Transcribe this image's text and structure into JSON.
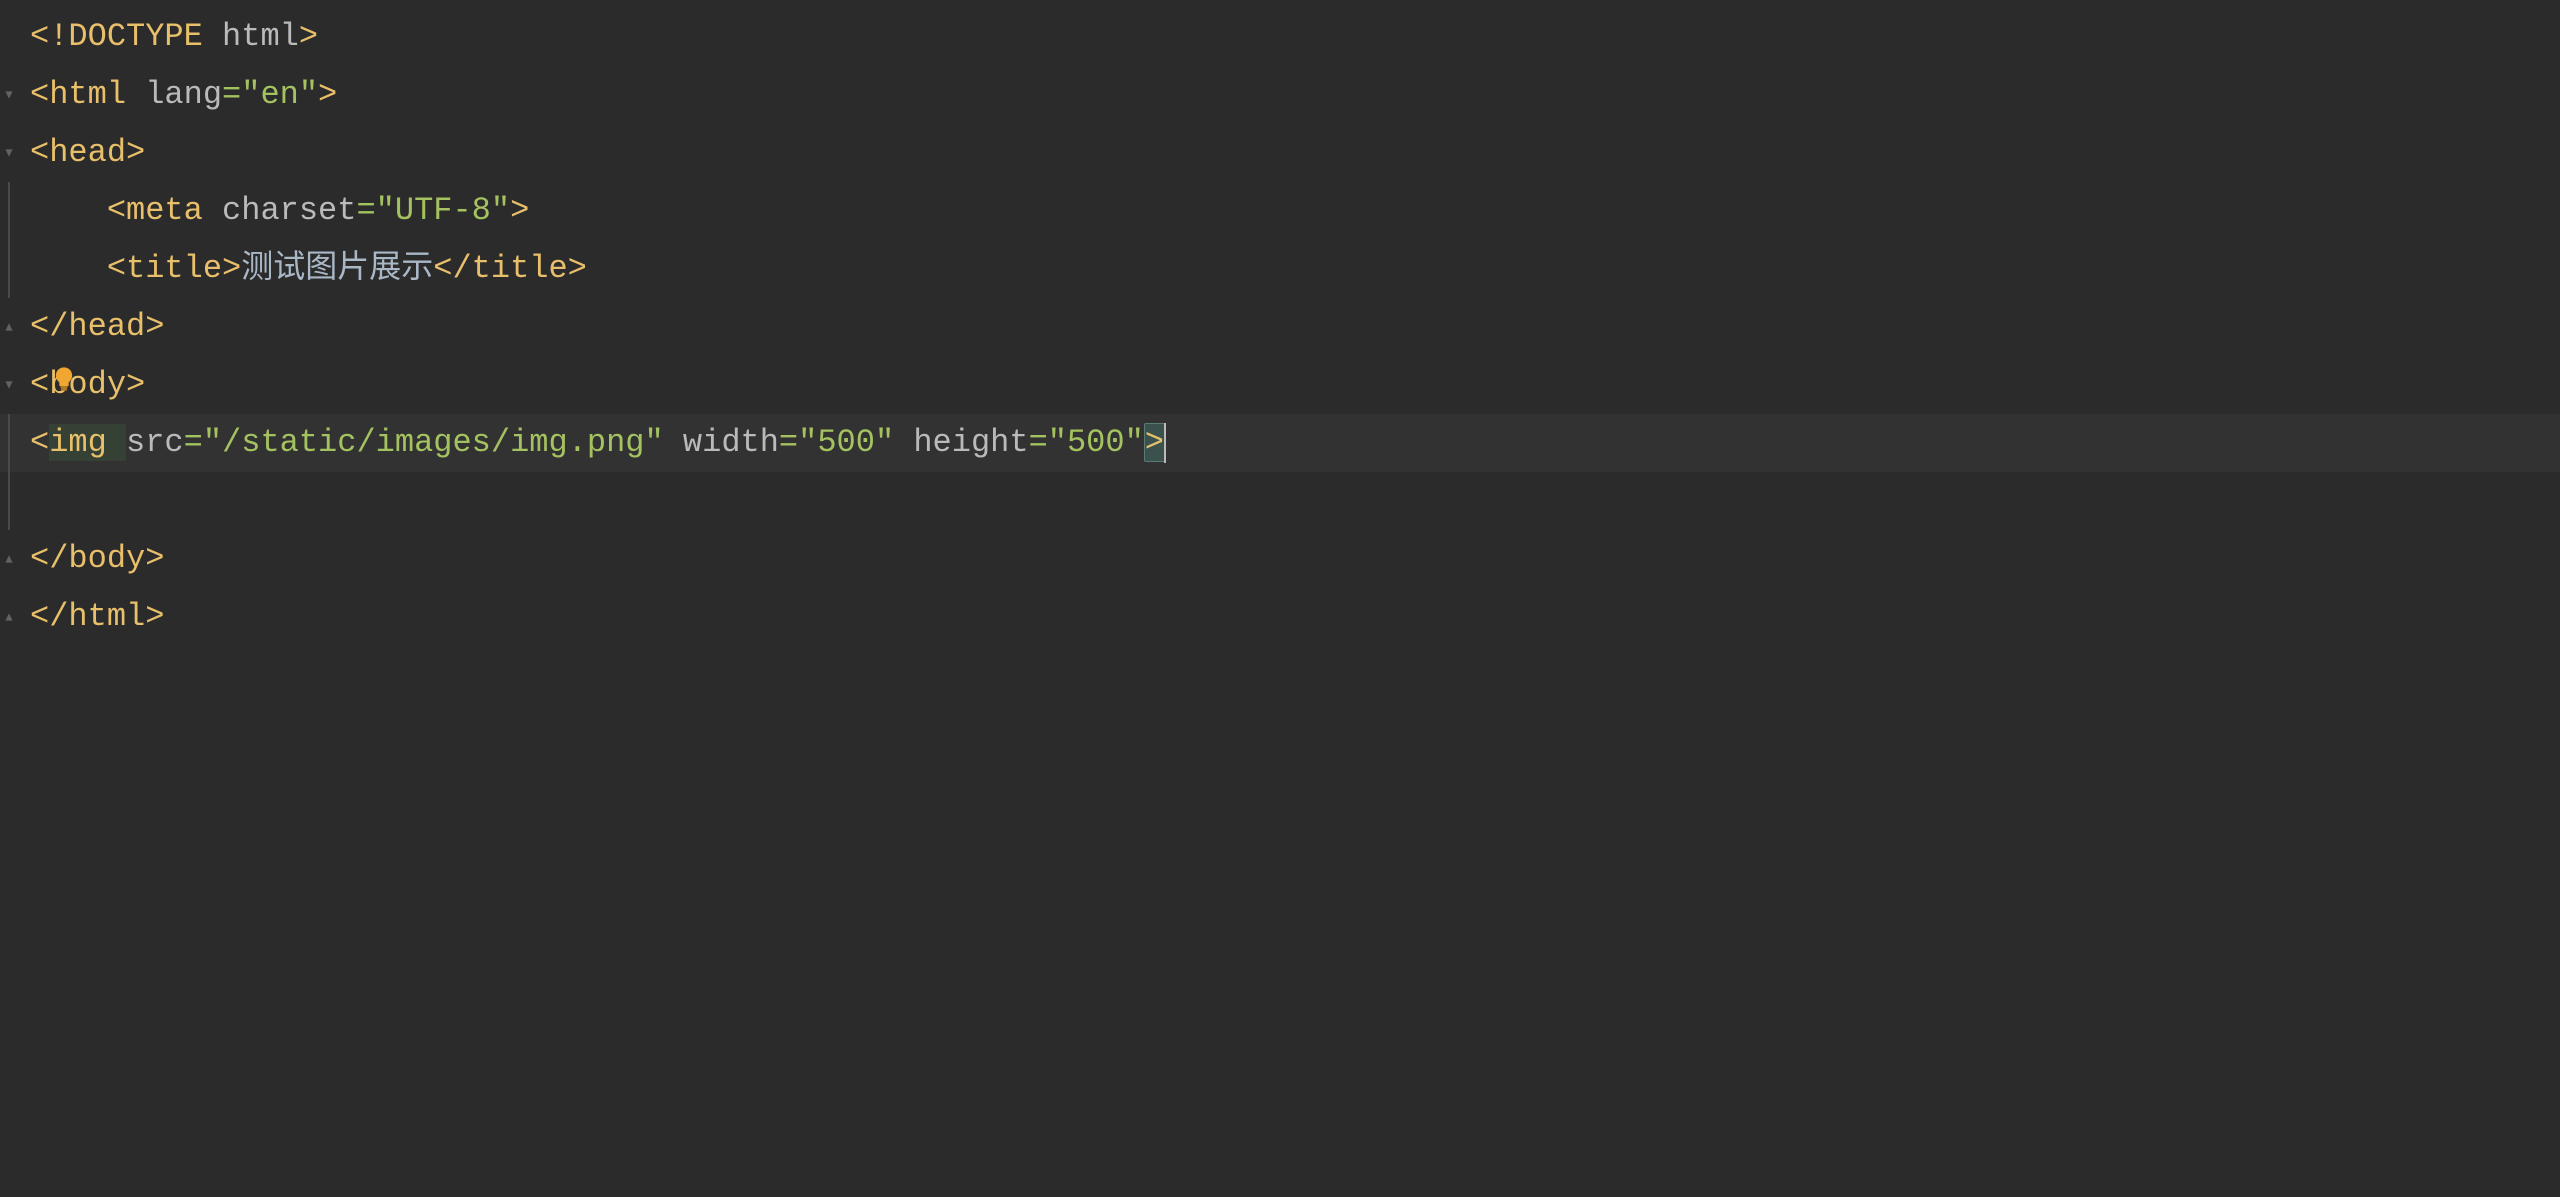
{
  "lines": [
    {
      "tokens": [
        {
          "t": "<!DOCTYPE ",
          "c": "tag"
        },
        {
          "t": "html",
          "c": "attr-name"
        },
        {
          "t": ">",
          "c": "tag"
        }
      ],
      "fold": "none",
      "indent": 0
    },
    {
      "tokens": [
        {
          "t": "<html ",
          "c": "tag"
        },
        {
          "t": "lang",
          "c": "attr-name"
        },
        {
          "t": "=\"en\"",
          "c": "attr-value"
        },
        {
          "t": ">",
          "c": "tag"
        }
      ],
      "fold": "open",
      "indent": 0
    },
    {
      "tokens": [
        {
          "t": "<head>",
          "c": "tag"
        }
      ],
      "fold": "open",
      "indent": 0
    },
    {
      "tokens": [
        {
          "t": "<meta ",
          "c": "tag"
        },
        {
          "t": "charset",
          "c": "attr-name"
        },
        {
          "t": "=\"UTF-8\"",
          "c": "attr-value"
        },
        {
          "t": ">",
          "c": "tag"
        }
      ],
      "fold": "line",
      "indent": 1
    },
    {
      "tokens": [
        {
          "t": "<title>",
          "c": "tag"
        },
        {
          "t": "测试图片展示",
          "c": "text"
        },
        {
          "t": "</title>",
          "c": "tag"
        }
      ],
      "fold": "line",
      "indent": 1
    },
    {
      "tokens": [
        {
          "t": "</head>",
          "c": "tag"
        }
      ],
      "fold": "close",
      "indent": 0
    },
    {
      "tokens": [
        {
          "t": "<body>",
          "c": "tag"
        }
      ],
      "fold": "open",
      "indent": 0,
      "bulb": true
    },
    {
      "tokens": [
        {
          "t": "<",
          "c": "tag"
        },
        {
          "t": "img ",
          "c": "tag",
          "underline": true
        },
        {
          "t": "src",
          "c": "attr-name"
        },
        {
          "t": "=\"/static/images/img.png\" ",
          "c": "attr-value"
        },
        {
          "t": "width",
          "c": "attr-name"
        },
        {
          "t": "=\"500\" ",
          "c": "attr-value"
        },
        {
          "t": "height",
          "c": "attr-name"
        },
        {
          "t": "=\"500\"",
          "c": "attr-value"
        },
        {
          "t": ">",
          "c": "tag",
          "matched": true
        }
      ],
      "fold": "line",
      "indent": 0,
      "highlighted": true,
      "cursor": true
    },
    {
      "tokens": [],
      "fold": "line",
      "indent": 0
    },
    {
      "tokens": [
        {
          "t": "</body>",
          "c": "tag"
        }
      ],
      "fold": "close",
      "indent": 0
    },
    {
      "tokens": [
        {
          "t": "</html>",
          "c": "tag"
        }
      ],
      "fold": "close",
      "indent": 0
    }
  ]
}
